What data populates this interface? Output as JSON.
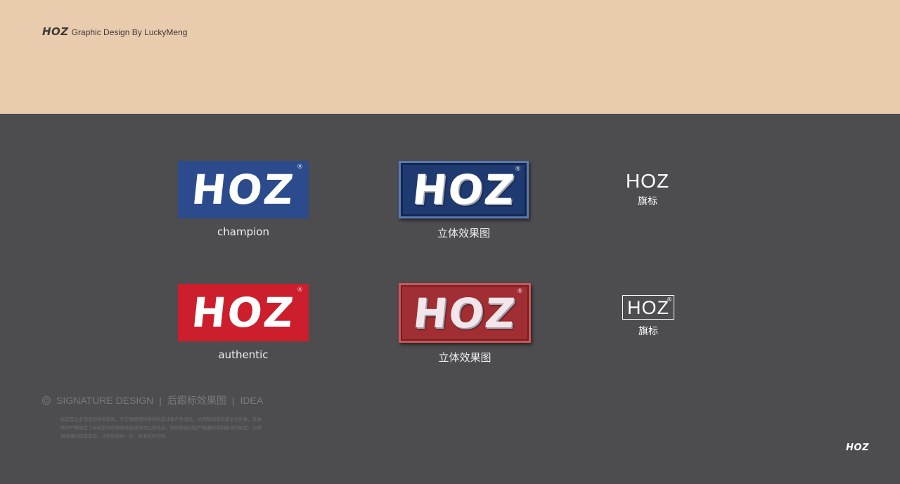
{
  "header": {
    "brand": "HOZ",
    "byline": "Graphic Design By LuckyMeng"
  },
  "logos": [
    {
      "word": "HOZ",
      "reg": "®",
      "caption": "champion"
    },
    {
      "word": "HOZ",
      "reg": "®",
      "caption": "立体效果图"
    },
    {
      "word": "HOZ",
      "reg": "®",
      "caption": "authentic"
    },
    {
      "word": "HOZ",
      "reg": "®",
      "caption": "立体效果图"
    }
  ],
  "flags": [
    {
      "word": "HOZ",
      "caption": "旗标"
    },
    {
      "word": "HOZ",
      "reg": "®",
      "caption": "旗标"
    }
  ],
  "footer": {
    "signature": "SIGNATURE DESIGN",
    "section": "后跟标效果图",
    "idea": "IDEA",
    "description": "标志是企业理念的视觉表现，不正确使用将会对标志印象产生混乱，从而削弱或损害企业形象，在本图中严格规定了标志制作的规格及各部分的比例关系，制作标志时应严格遵照本制图法的规定，以得到准确的标志造型，从而达到统一化、标准化的识别。",
    "corner_brand": "HOZ"
  },
  "colors": {
    "top_band": "#e9cbad",
    "background": "#4d4c4f",
    "blue": "#2b4b8c",
    "red": "#cc1e2c"
  }
}
